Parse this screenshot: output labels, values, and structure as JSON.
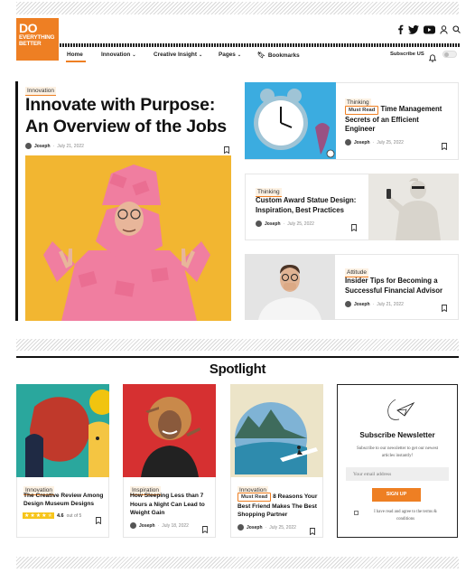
{
  "brand": {
    "line1": "DO",
    "line2": "EVERYTHING",
    "line3": "BETTER",
    "color": "#ee7f23"
  },
  "nav": {
    "home": "Home",
    "innovation": "Innovation",
    "creative": "Creative Insight",
    "pages": "Pages",
    "bookmarks": "Bookmarks",
    "subscribe": "Subscribe US"
  },
  "hero": {
    "category": "Innovation",
    "title_l1": "Innovate with Purpose:",
    "title_l2": "An Overview of the Jobs",
    "author": "Joseph",
    "date": "July 21, 2022"
  },
  "side": [
    {
      "category": "Thinking",
      "tag": "Must Read",
      "title_rest": "Time Management",
      "title_l2": "Secrets of an Efficient",
      "title_l3": "Engineer",
      "author": "Joseph",
      "date": "July 25, 2022"
    },
    {
      "category": "Thinking",
      "title_l1": "Custom Award Statue Design:",
      "title_l2": "Inspiration, Best Practices",
      "author": "Joseph",
      "date": "July 25, 2022"
    },
    {
      "category": "Attitude",
      "title_l1": "Insider Tips for Becoming a",
      "title_l2": "Successful Financial Advisor",
      "author": "Joseph",
      "date": "July 21, 2022"
    }
  ],
  "spotlight": {
    "heading": "Spotlight"
  },
  "cards": [
    {
      "category": "Innovation",
      "title_l1": "The Creative Review Among",
      "title_l2": "Design Museum Designs",
      "rating": "4.6",
      "rating_suffix": "out of 5",
      "stars": 4.6
    },
    {
      "category": "Inspiration",
      "title_l1": "How Sleeping Less than 7",
      "title_l2": "Hours a Night Can Lead to",
      "title_l3": "Weight Gain",
      "author": "Joseph",
      "date": "July 18, 2022"
    },
    {
      "category": "Innovation",
      "tag": "Must Read",
      "title_rest": "8 Reasons Your",
      "title_l2": "Best Friend Makes The Best",
      "title_l3": "Shopping Partner",
      "author": "Joseph",
      "date": "July 25, 2022"
    }
  ],
  "newsletter": {
    "title": "Subscribe Newsletter",
    "desc_l1": "Subscribe to our newsletter to get our newest",
    "desc_l2": "articles instantly!",
    "placeholder": "Your email address",
    "button": "SIGN UP",
    "agree_l1": "I have read and agree to the terms &",
    "agree_l2": "conditions"
  }
}
